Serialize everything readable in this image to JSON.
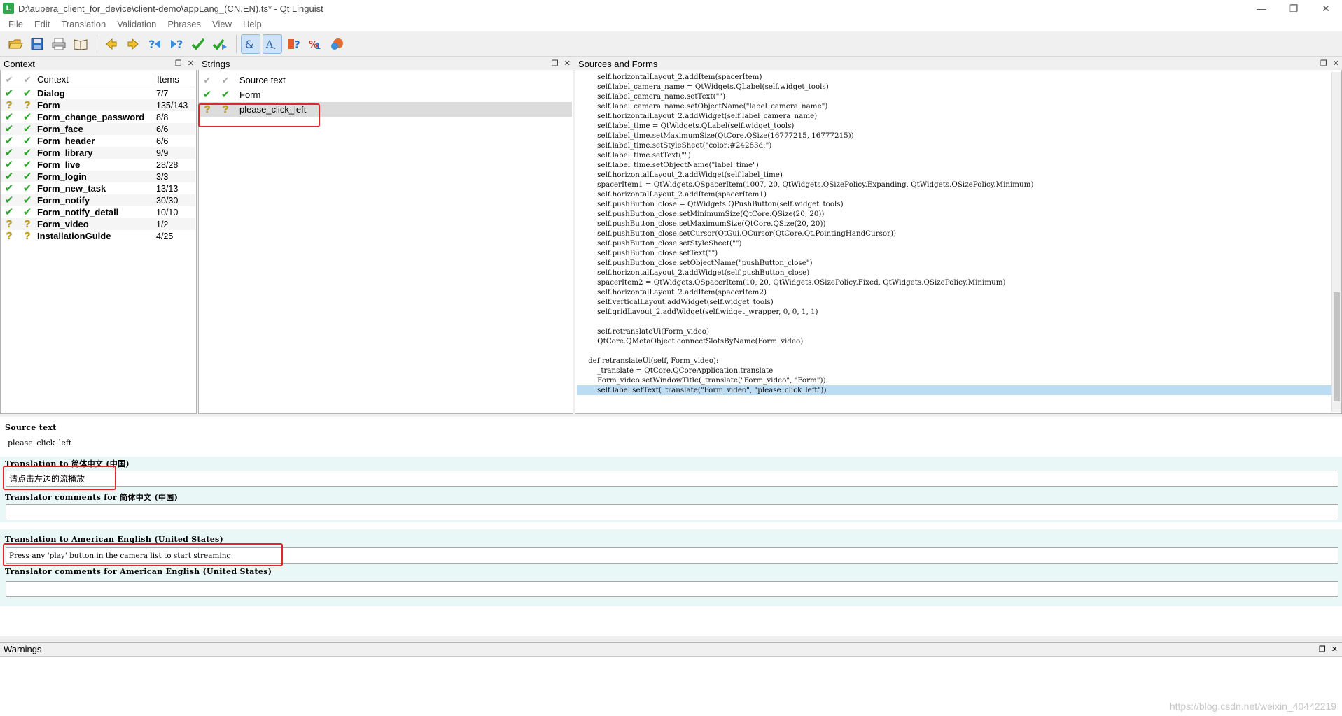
{
  "window": {
    "title": "D:\\aupera_client_for_device\\client-demo\\appLang_(CN,EN).ts* - Qt Linguist",
    "app_icon": "L",
    "controls": [
      "—",
      "❐",
      "✕"
    ]
  },
  "menu": [
    "File",
    "Edit",
    "Translation",
    "Validation",
    "Phrases",
    "View",
    "Help"
  ],
  "toolbar": [
    "open-icon",
    "save-icon",
    "print-icon",
    "phrasebook-icon",
    "prev-icon",
    "next-icon",
    "prev-unfinished-icon",
    "next-unfinished-icon",
    "done-icon",
    "done-next-icon",
    "accelerators-icon",
    "punctuation-icon",
    "phrase-match-icon",
    "placeholder-icon",
    "length-icon"
  ],
  "context_panel": {
    "title": "Context",
    "headers": {
      "context": "Context",
      "items": "Items"
    },
    "rows": [
      {
        "name": "Dialog",
        "items": "7/7",
        "status": "done"
      },
      {
        "name": "Form",
        "items": "135/143",
        "status": "unfinished"
      },
      {
        "name": "Form_change_password",
        "items": "8/8",
        "status": "done"
      },
      {
        "name": "Form_face",
        "items": "6/6",
        "status": "done"
      },
      {
        "name": "Form_header",
        "items": "6/6",
        "status": "done"
      },
      {
        "name": "Form_library",
        "items": "9/9",
        "status": "done"
      },
      {
        "name": "Form_live",
        "items": "28/28",
        "status": "done"
      },
      {
        "name": "Form_login",
        "items": "3/3",
        "status": "done"
      },
      {
        "name": "Form_new_task",
        "items": "13/13",
        "status": "done"
      },
      {
        "name": "Form_notify",
        "items": "30/30",
        "status": "done"
      },
      {
        "name": "Form_notify_detail",
        "items": "10/10",
        "status": "done"
      },
      {
        "name": "Form_video",
        "items": "1/2",
        "status": "unfinished"
      },
      {
        "name": "InstallationGuide",
        "items": "4/25",
        "status": "unfinished"
      }
    ]
  },
  "strings_panel": {
    "title": "Strings",
    "header": "Source text",
    "rows": [
      {
        "text": "Form",
        "status": "done"
      },
      {
        "text": "please_click_left",
        "status": "unfinished"
      }
    ]
  },
  "sources_panel": {
    "title": "Sources and Forms",
    "lines": [
      "        self.horizontalLayout_2.addItem(spacerItem)",
      "        self.label_camera_name = QtWidgets.QLabel(self.widget_tools)",
      "        self.label_camera_name.setText(\"\")",
      "        self.label_camera_name.setObjectName(\"label_camera_name\")",
      "        self.horizontalLayout_2.addWidget(self.label_camera_name)",
      "        self.label_time = QtWidgets.QLabel(self.widget_tools)",
      "        self.label_time.setMaximumSize(QtCore.QSize(16777215, 16777215))",
      "        self.label_time.setStyleSheet(\"color:#24283d;\")",
      "        self.label_time.setText(\"\")",
      "        self.label_time.setObjectName(\"label_time\")",
      "        self.horizontalLayout_2.addWidget(self.label_time)",
      "        spacerItem1 = QtWidgets.QSpacerItem(1007, 20, QtWidgets.QSizePolicy.Expanding, QtWidgets.QSizePolicy.Minimum)",
      "        self.horizontalLayout_2.addItem(spacerItem1)",
      "        self.pushButton_close = QtWidgets.QPushButton(self.widget_tools)",
      "        self.pushButton_close.setMinimumSize(QtCore.QSize(20, 20))",
      "        self.pushButton_close.setMaximumSize(QtCore.QSize(20, 20))",
      "        self.pushButton_close.setCursor(QtGui.QCursor(QtCore.Qt.PointingHandCursor))",
      "        self.pushButton_close.setStyleSheet(\"\")",
      "        self.pushButton_close.setText(\"\")",
      "        self.pushButton_close.setObjectName(\"pushButton_close\")",
      "        self.horizontalLayout_2.addWidget(self.pushButton_close)",
      "        spacerItem2 = QtWidgets.QSpacerItem(10, 20, QtWidgets.QSizePolicy.Fixed, QtWidgets.QSizePolicy.Minimum)",
      "        self.horizontalLayout_2.addItem(spacerItem2)",
      "        self.verticalLayout.addWidget(self.widget_tools)",
      "        self.gridLayout_2.addWidget(self.widget_wrapper, 0, 0, 1, 1)",
      "",
      "        self.retranslateUi(Form_video)",
      "        QtCore.QMetaObject.connectSlotsByName(Form_video)",
      "",
      "    def retranslateUi(self, Form_video):",
      "        _translate = QtCore.QCoreApplication.translate",
      "        Form_video.setWindowTitle(_translate(\"Form_video\", \"Form\"))",
      "        self.label.setText(_translate(\"Form_video\", \"please_click_left\"))"
    ]
  },
  "editor": {
    "source_label": "Source text",
    "source_value": "please_click_left",
    "zh_translation_label": "Translation to 简体中文 (中国)",
    "zh_translation_value": "请点击左边的流播放",
    "zh_comments_label": "Translator comments for 简体中文 (中国)",
    "zh_comments_value": "",
    "en_translation_label": "Translation to American English (United States)",
    "en_translation_value": "Press any 'play' button in the camera list to start streaming",
    "en_comments_label": "Translator comments for American English (United States)",
    "en_comments_value": ""
  },
  "warnings_panel": {
    "title": "Warnings"
  },
  "watermark": "https://blog.csdn.net/weixin_40442219"
}
